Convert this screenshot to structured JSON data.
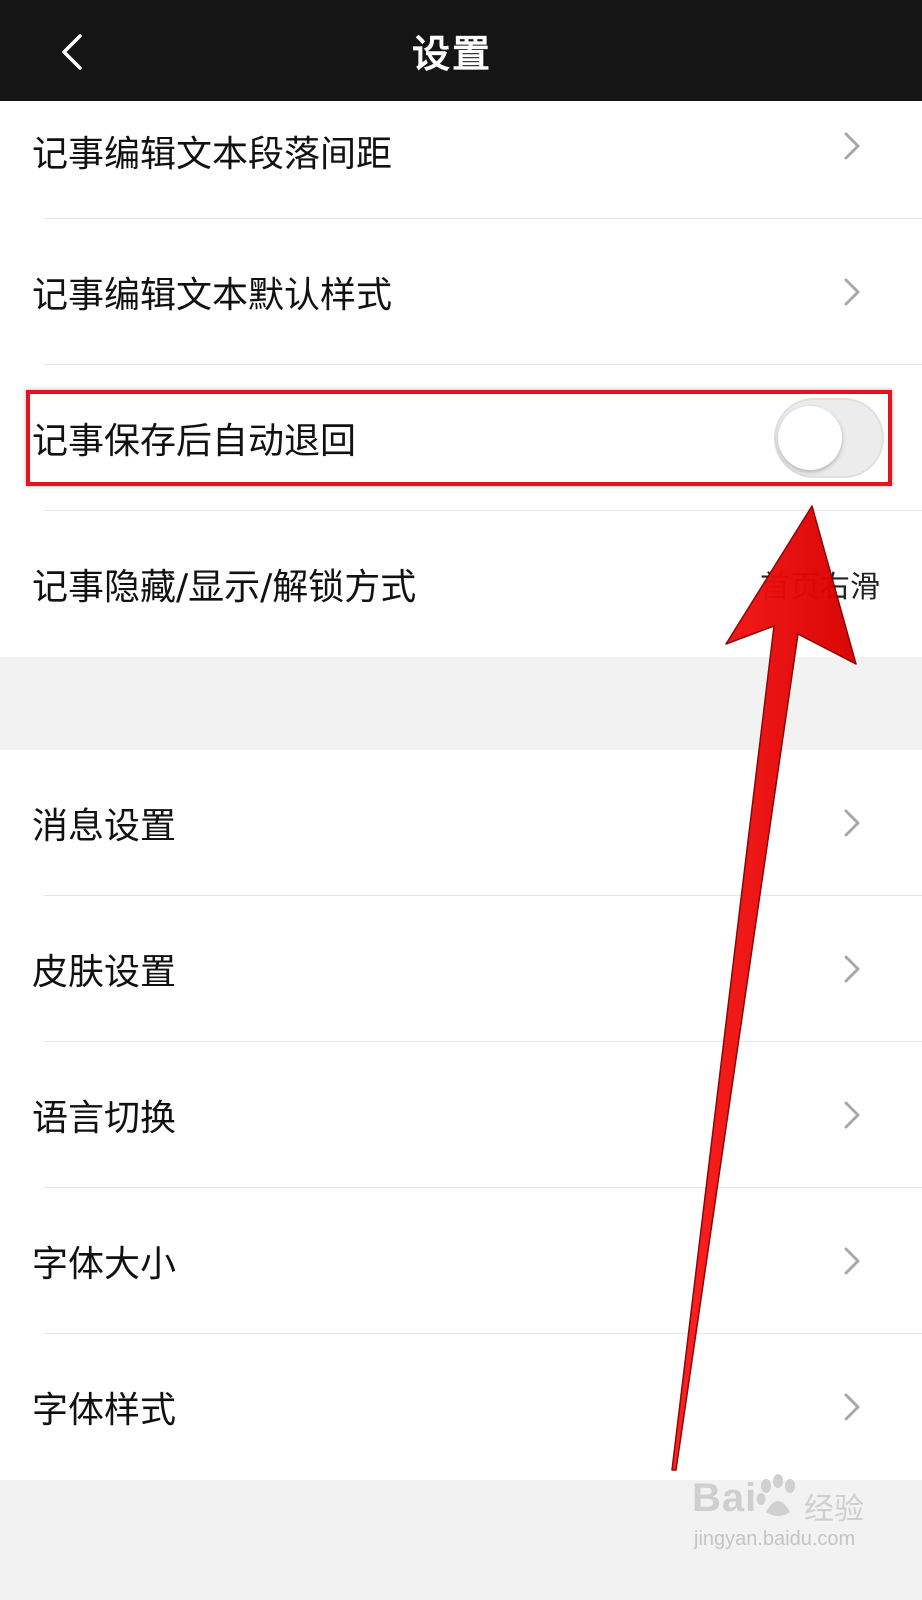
{
  "header": {
    "title": "设置",
    "back_icon": "chevron-left-icon"
  },
  "group1": {
    "items": [
      {
        "label": "记事编辑文本段落间距",
        "control": "chevron"
      },
      {
        "label": "记事编辑文本默认样式",
        "control": "chevron"
      },
      {
        "label": "记事保存后自动退回",
        "control": "toggle",
        "toggle_on": false
      },
      {
        "label": "记事隐藏/显示/解锁方式",
        "control": "value",
        "value": "首页右滑"
      }
    ]
  },
  "group2": {
    "items": [
      {
        "label": "消息设置",
        "control": "chevron"
      },
      {
        "label": "皮肤设置",
        "control": "chevron"
      },
      {
        "label": "语言切换",
        "control": "chevron"
      },
      {
        "label": "字体大小",
        "control": "chevron"
      },
      {
        "label": "字体样式",
        "control": "chevron"
      }
    ]
  },
  "annotation": {
    "highlight_color": "#e3141b",
    "arrow_color": "#ff0000"
  },
  "watermark": {
    "brand": "Bai",
    "brand_suffix": "经验",
    "url": "jingyan.baidu.com"
  },
  "colors": {
    "header_bg": "#151515",
    "page_bg": "#f2f2f2",
    "row_bg": "#ffffff"
  }
}
